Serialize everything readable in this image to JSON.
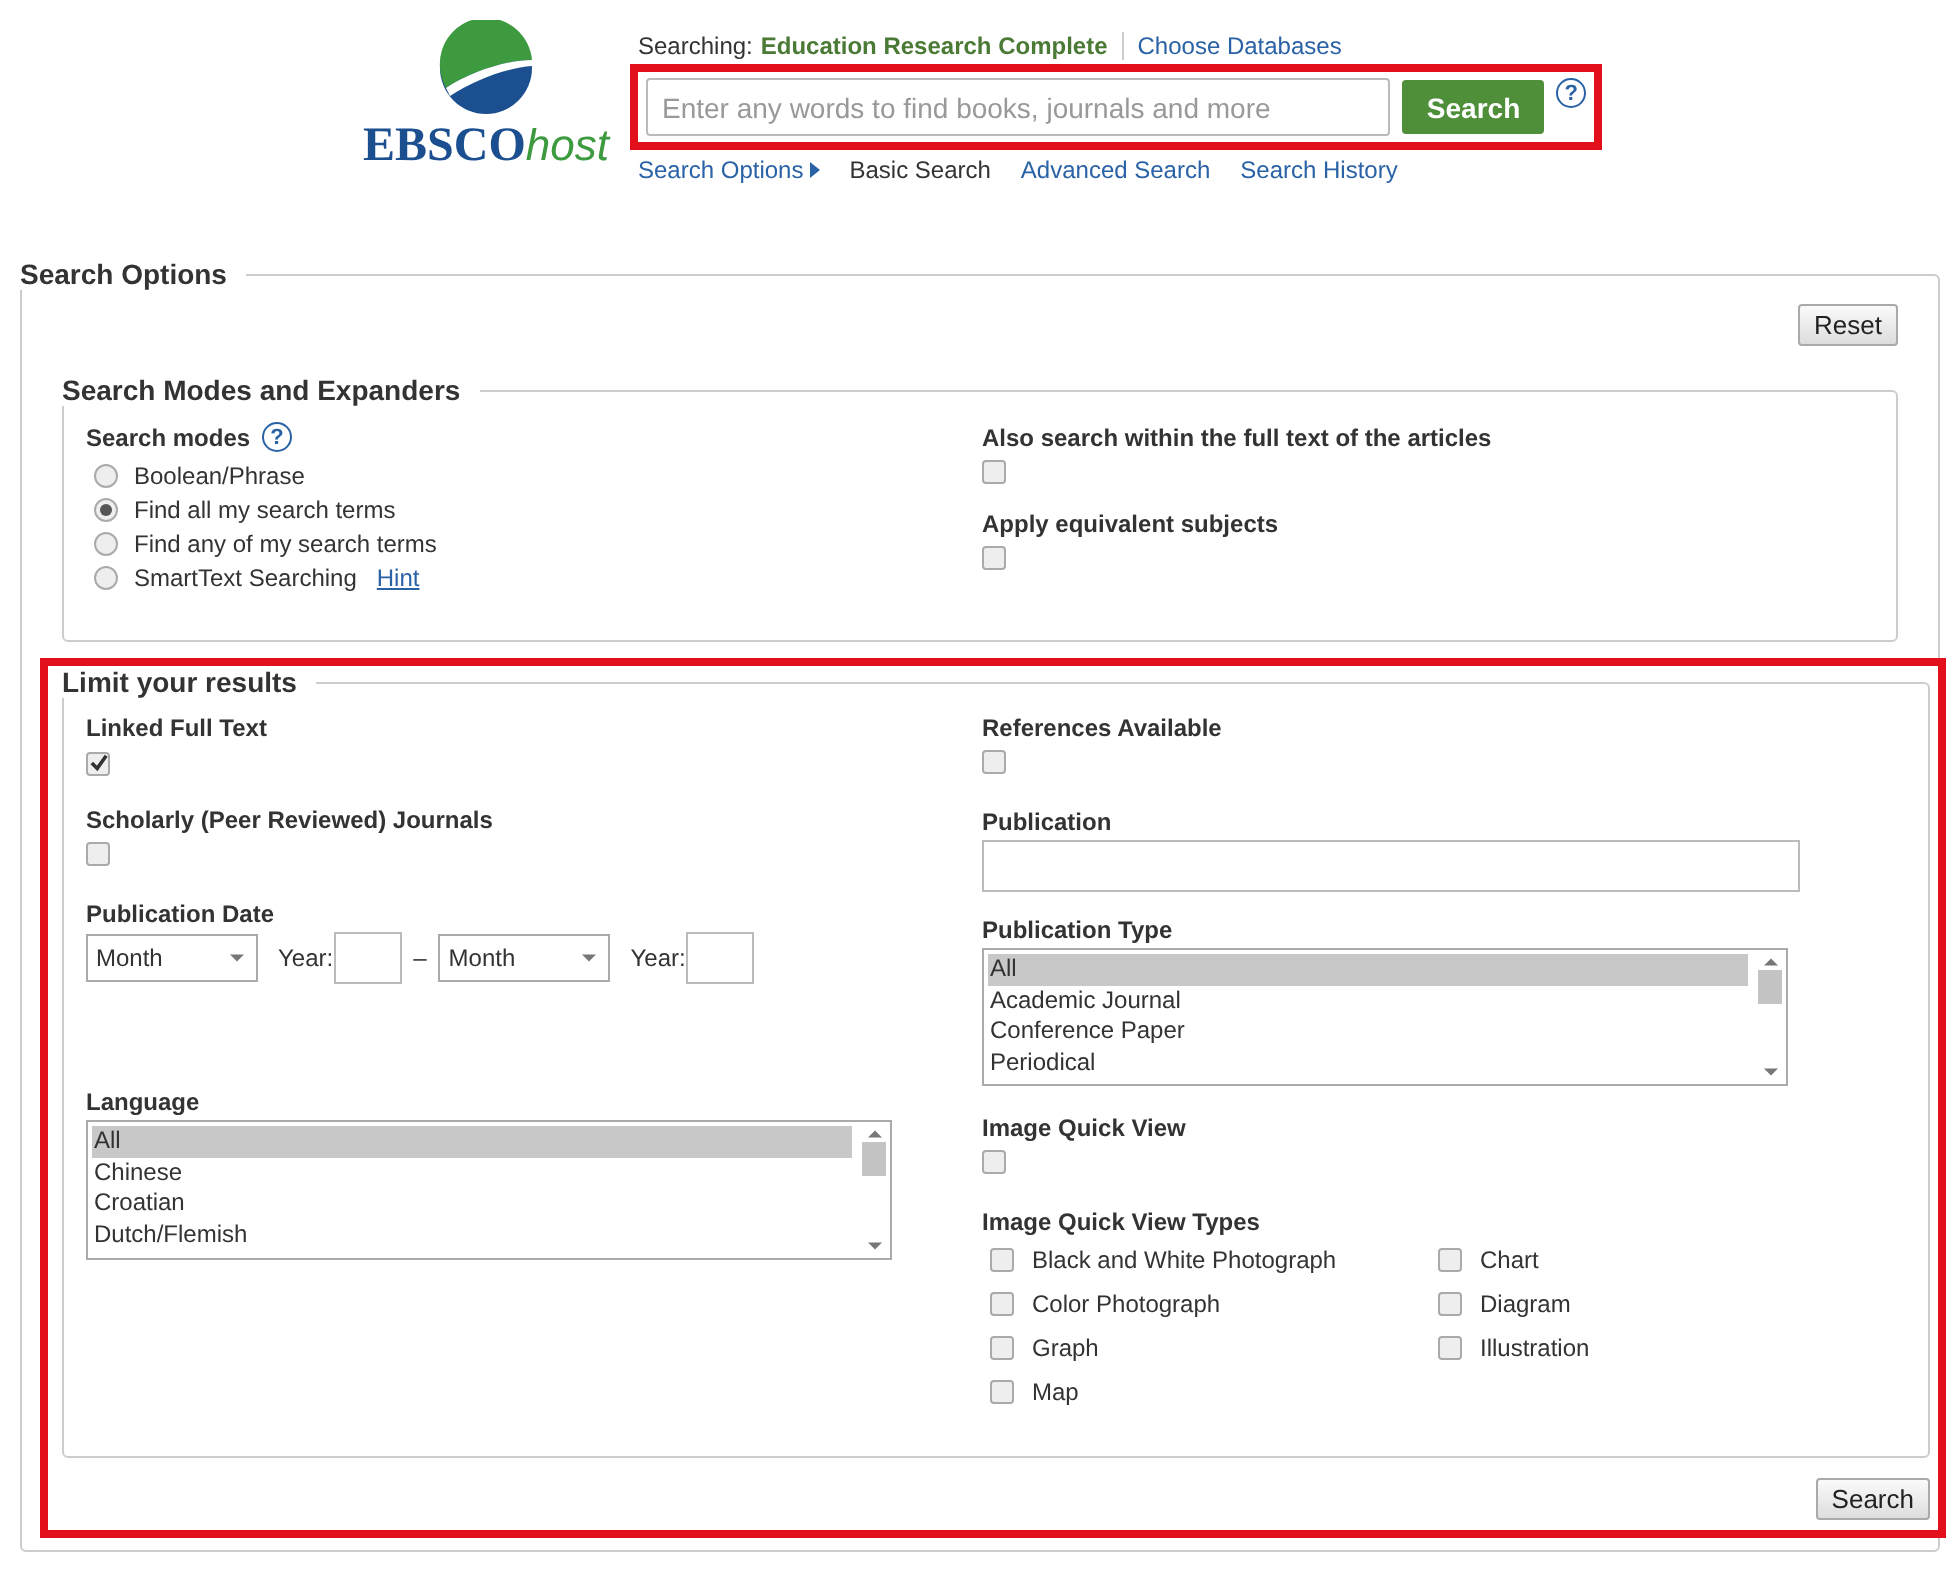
{
  "header": {
    "logo": {
      "brand": "EBSCO",
      "suffix": "host"
    },
    "searching_label": "Searching:",
    "database": "Education Research Complete",
    "choose_databases": "Choose Databases",
    "search_bar": {
      "placeholder": "Enter any words to find books, journals and more",
      "button": "Search",
      "help": "?",
      "highlighted": true
    },
    "nav": [
      {
        "label": "Search Options",
        "kind": "toggle",
        "selected": false
      },
      {
        "label": "Basic Search",
        "kind": "link",
        "selected": true
      },
      {
        "label": "Advanced Search",
        "kind": "link",
        "selected": false
      },
      {
        "label": "Search History",
        "kind": "link",
        "selected": false
      }
    ]
  },
  "search_options": {
    "title": "Search Options",
    "reset": "Reset",
    "modes": {
      "title": "Search Modes and Expanders",
      "label": "Search modes",
      "help": "?",
      "options": [
        {
          "label": "Boolean/Phrase",
          "selected": false
        },
        {
          "label": "Find all my search terms",
          "selected": true
        },
        {
          "label": "Find any of my search terms",
          "selected": false
        },
        {
          "label": "SmartText Searching",
          "selected": false,
          "hint": "Hint"
        }
      ],
      "expanders": [
        {
          "label": "Also search within the full text of the articles",
          "checked": false
        },
        {
          "label": "Apply equivalent subjects",
          "checked": false
        }
      ]
    },
    "limits": {
      "title": "Limit your results",
      "highlighted": true,
      "left": [
        {
          "kind": "checkbox",
          "label": "Linked Full Text",
          "checked": true
        },
        {
          "kind": "checkbox",
          "label": "Scholarly (Peer Reviewed) Journals",
          "checked": false
        },
        {
          "kind": "date",
          "label": "Publication Date",
          "from_month": "Month",
          "year_label": "Year:",
          "dash": "–",
          "to_month": "Month",
          "to_year_label": "Year:"
        },
        {
          "kind": "list",
          "label": "Language",
          "options": [
            {
              "label": "All",
              "selected": true
            },
            {
              "label": "Chinese",
              "selected": false
            },
            {
              "label": "Croatian",
              "selected": false
            },
            {
              "label": "Dutch/Flemish",
              "selected": false
            }
          ]
        }
      ],
      "right": [
        {
          "kind": "checkbox",
          "label": "References Available",
          "checked": false
        },
        {
          "kind": "text",
          "label": "Publication"
        },
        {
          "kind": "list",
          "label": "Publication Type",
          "options": [
            {
              "label": "All",
              "selected": true
            },
            {
              "label": "Academic Journal",
              "selected": false
            },
            {
              "label": "Conference Paper",
              "selected": false
            },
            {
              "label": "Periodical",
              "selected": false
            }
          ]
        },
        {
          "kind": "checkbox",
          "label": "Image Quick View",
          "checked": false
        },
        {
          "kind": "checkgrid",
          "label": "Image Quick View Types",
          "options": [
            {
              "label": "Black and White Photograph",
              "checked": false
            },
            {
              "label": "Chart",
              "checked": false
            },
            {
              "label": "Color Photograph",
              "checked": false
            },
            {
              "label": "Diagram",
              "checked": false
            },
            {
              "label": "Graph",
              "checked": false
            },
            {
              "label": "Illustration",
              "checked": false
            },
            {
              "label": "Map",
              "checked": false
            }
          ]
        }
      ],
      "search_button": "Search"
    }
  }
}
